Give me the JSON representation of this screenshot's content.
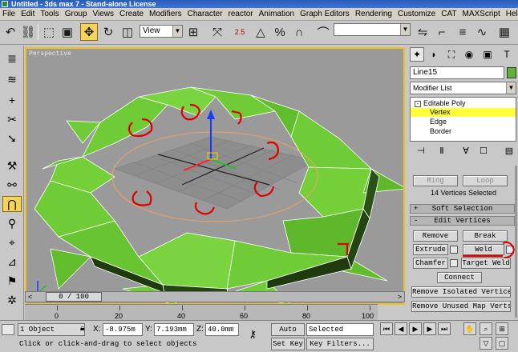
{
  "window": {
    "title": "Untitled - 3ds max 7 - Stand-alone License"
  },
  "menu": [
    "File",
    "Edit",
    "Tools",
    "Group",
    "Views",
    "Create",
    "Modifiers",
    "Character",
    "reactor",
    "Animation",
    "Graph Editors",
    "Rendering",
    "Customize",
    "CAT",
    "MAXScript",
    "Help"
  ],
  "toolbar": {
    "view_dropdown": "View",
    "snap_angle_label": "2.5",
    "icons": [
      "undo-icon",
      "redo-icon",
      "select-link-icon",
      "select-object-icon",
      "select-region-icon",
      "select-move-icon",
      "select-rotate-icon",
      "select-scale-icon",
      "snap-icon",
      "mirror-icon",
      "align-icon",
      "named-selection-icon",
      "render-icon"
    ]
  },
  "viewport": {
    "label": "Perspective"
  },
  "command_panel": {
    "object_name": "Line15",
    "object_color": "#5bb532",
    "modifier_list_label": "Modifier List",
    "stack": [
      {
        "label": "Editable Poly",
        "selected": false
      },
      {
        "label": "Vertex",
        "selected": true
      },
      {
        "label": "Edge",
        "selected": false
      },
      {
        "label": "Border",
        "selected": false
      }
    ],
    "selection": {
      "ring_label": "Ring",
      "loop_label": "Loop",
      "status": "14 Vertices Selected"
    },
    "soft_selection": {
      "sign": "+",
      "title": "Soft Selection"
    },
    "edit_vertices": {
      "sign": "-",
      "title": "Edit Vertices",
      "remove_label": "Remove",
      "break_label": "Break",
      "extrude_label": "Extrude",
      "weld_label": "Weld",
      "chamfer_label": "Chamfer",
      "target_weld_label": "Target Weld",
      "connect_label": "Connect",
      "remove_isolated_label": "Remove Isolated Vertices",
      "remove_unused_label": "Remove Unused Map Verts"
    }
  },
  "time": {
    "slider_label": "0 / 100",
    "ticks": [
      "0",
      "20",
      "40",
      "60",
      "80",
      "100"
    ]
  },
  "status": {
    "selection_count": "1 Object",
    "x_label": "X:",
    "x_value": "-8.975m",
    "y_label": "Y:",
    "y_value": "7.193mm",
    "z_label": "Z:",
    "z_value": "40.0mm",
    "auto_key_label": "Auto Key",
    "set_key_label": "Set Key",
    "key_mode_value": "Selected",
    "key_filters_label": "Key Filters...",
    "prompt": "Click or click-and-drag to select objects"
  }
}
